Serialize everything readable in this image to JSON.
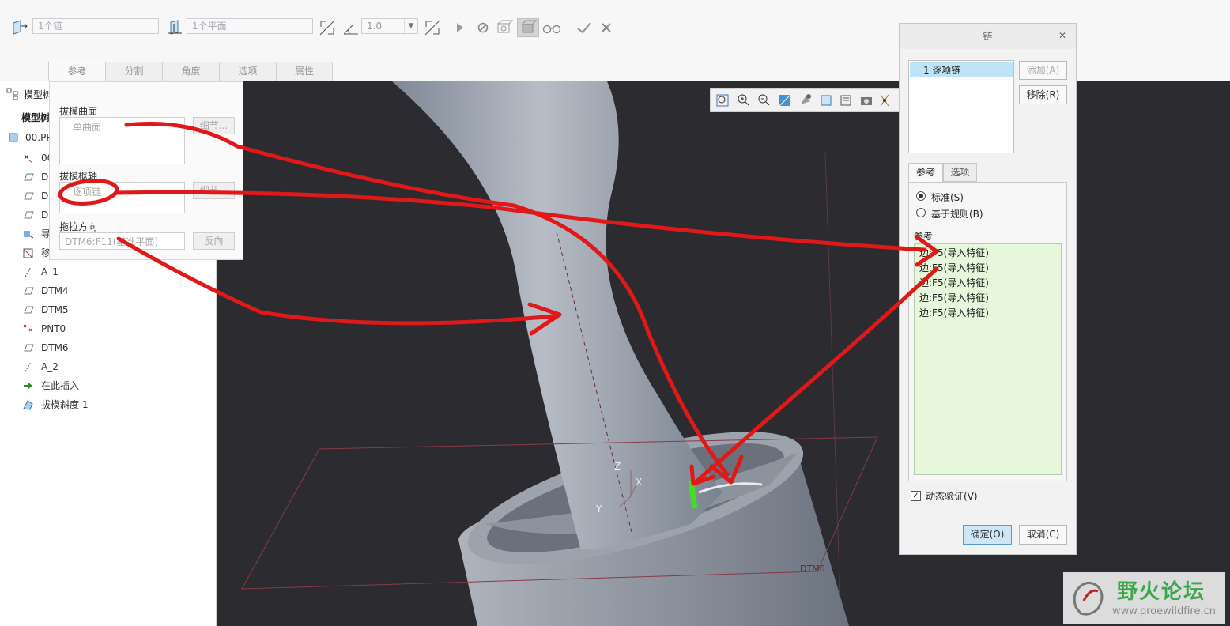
{
  "ribbon": {
    "chain_field": "1个链",
    "plane_field": "1个平面",
    "angle_value": "1.0",
    "tabs": [
      "参考",
      "分割",
      "角度",
      "选项",
      "属性"
    ],
    "icons": [
      "draft-surface-icon",
      "pivot-plane-icon",
      "flip-angle-icon",
      "angle-icon",
      "flip-direction-icon",
      "play-icon",
      "pause-icon",
      "preview-icon",
      "verify-icon",
      "glasses-icon",
      "confirm-icon",
      "cancel-icon"
    ]
  },
  "model_tree": {
    "header_label": "模型树",
    "sub_label": "模型树",
    "root_label": "00.PR",
    "items": [
      {
        "icon": "coordinate-system-icon",
        "label": "00"
      },
      {
        "icon": "datum-plane-icon",
        "label": "D"
      },
      {
        "icon": "datum-plane-icon",
        "label": "D"
      },
      {
        "icon": "datum-plane-icon",
        "label": "D"
      },
      {
        "icon": "import-feature-icon",
        "label": "导"
      },
      {
        "icon": "sketch-icon",
        "label": "移"
      },
      {
        "icon": "axis-icon",
        "label": "A_1"
      },
      {
        "icon": "datum-plane-icon",
        "label": "DTM4"
      },
      {
        "icon": "datum-plane-icon",
        "label": "DTM5"
      },
      {
        "icon": "datum-point-icon",
        "label": "PNT0"
      },
      {
        "icon": "datum-plane-icon",
        "label": "DTM6"
      },
      {
        "icon": "axis-icon",
        "label": "A_2"
      },
      {
        "icon": "insert-here-arrow-icon",
        "label": "在此插入"
      },
      {
        "icon": "draft-feature-icon",
        "label": "拔模斜度 1"
      }
    ]
  },
  "ref_panel": {
    "draft_surface_label": "拔模曲面",
    "draft_surface_value": "单曲面",
    "detail_btn_1": "细节...",
    "hinge_label": "拔模枢轴",
    "hinge_value": "逐项链",
    "detail_btn_2": "细节...",
    "pull_dir_label": "拖拉方向",
    "pull_dir_value": "DTM6:F11(基准平面)",
    "flip_btn": "反向"
  },
  "chain_dialog": {
    "title": "链",
    "chain_item": "1 逐项链",
    "add_btn": "添加(A)",
    "remove_btn": "移除(R)",
    "tabs": [
      "参考",
      "选项"
    ],
    "radio_standard": "标准(S)",
    "radio_rule": "基于规则(B)",
    "refs_label": "参考",
    "refs": [
      "边:F5(导入特征)",
      "边:F5(导入特征)",
      "边:F5(导入特征)",
      "边:F5(导入特征)",
      "边:F5(导入特征)"
    ],
    "dynamic_check": "动态验证(V)",
    "dynamic_checked": true,
    "ok_btn": "确定(O)",
    "cancel_btn": "取消(C)"
  },
  "viewport": {
    "axis_labels": [
      "Z",
      "X",
      "Y"
    ],
    "plane_label": "DTM6"
  },
  "watermark": {
    "title": "野火论坛",
    "url": "www.proewildfire.cn"
  },
  "colors": {
    "annotation_red": "#e01818",
    "selection_green": "#44dd22",
    "list_highlight": "#bfe3f7",
    "refs_bg": "#e6f7dc",
    "watermark_green": "#3aa84a"
  }
}
